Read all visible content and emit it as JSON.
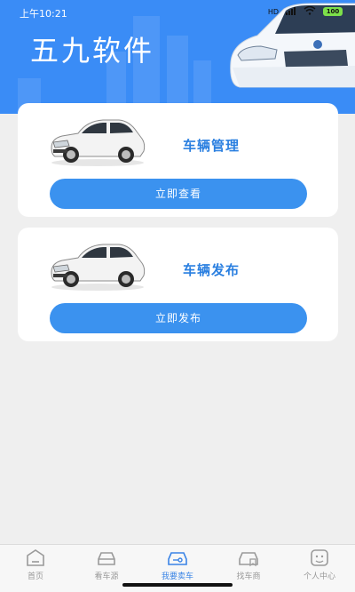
{
  "status_bar": {
    "time": "上午10:21",
    "network": "HD",
    "battery": "100"
  },
  "header": {
    "brand": "五九软件"
  },
  "cards": [
    {
      "title": "车辆管理",
      "button": "立即查看"
    },
    {
      "title": "车辆发布",
      "button": "立即发布"
    }
  ],
  "tabbar": {
    "items": [
      {
        "label": "首页",
        "icon": "home-icon"
      },
      {
        "label": "看车源",
        "icon": "car-front-icon"
      },
      {
        "label": "我要卖车",
        "icon": "car-key-icon"
      },
      {
        "label": "找车商",
        "icon": "car-shop-icon"
      },
      {
        "label": "个人中心",
        "icon": "face-icon"
      }
    ],
    "active_index": 2
  },
  "colors": {
    "header": "#3a8cf6",
    "accent": "#3b92ef",
    "title": "#2a7fe0",
    "background": "#efefef"
  }
}
